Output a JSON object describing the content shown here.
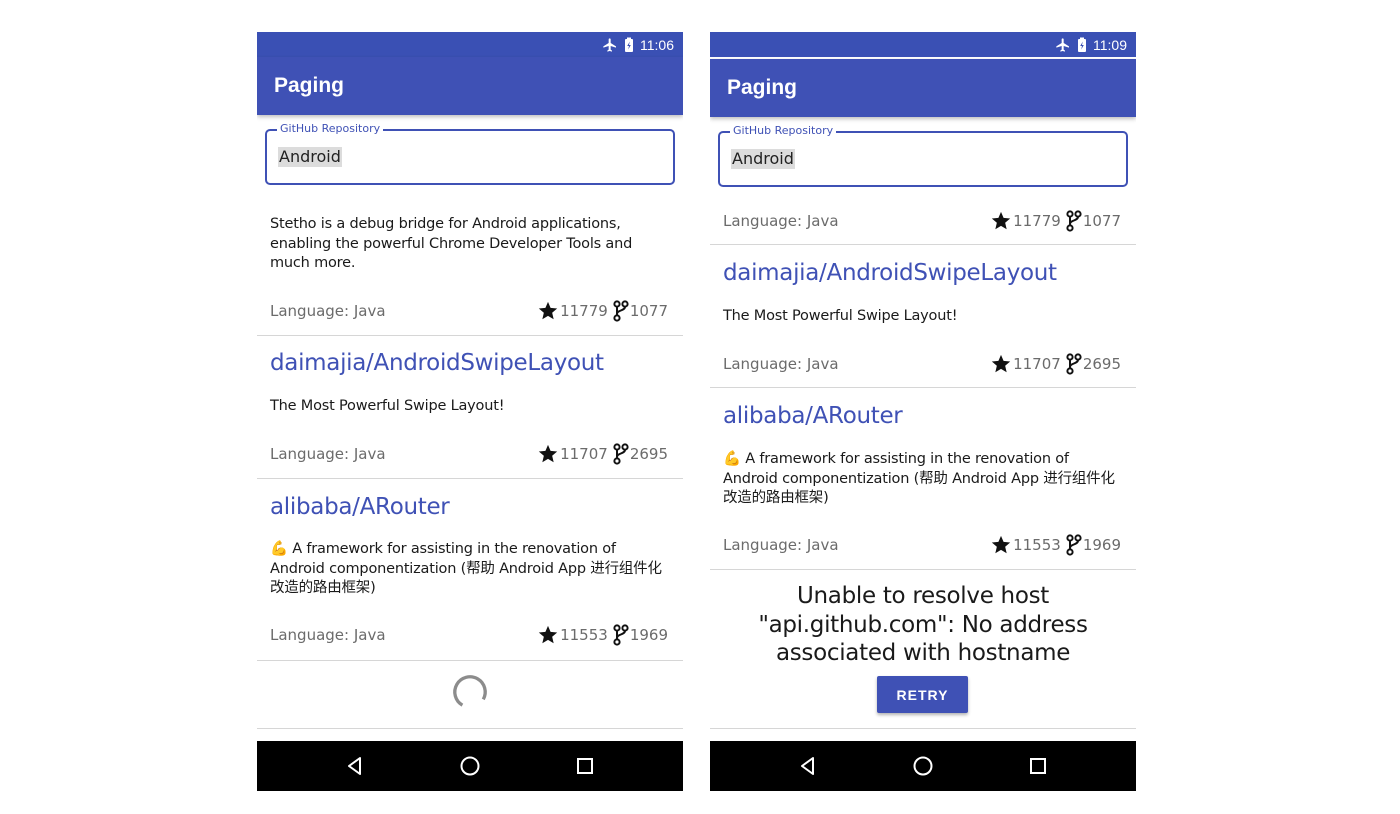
{
  "left": {
    "status": {
      "time": "11:06"
    },
    "app_title": "Paging",
    "search": {
      "label": "GitHub Repository",
      "value": "Android"
    },
    "items": [
      {
        "description": "Stetho is a debug bridge for Android applications, enabling the powerful Chrome Developer Tools and much more.",
        "language": "Language: Java",
        "stars": "11779",
        "forks": "1077"
      },
      {
        "name": "daimajia/AndroidSwipeLayout",
        "description": "The Most Powerful Swipe Layout!",
        "language": "Language: Java",
        "stars": "11707",
        "forks": "2695"
      },
      {
        "name": "alibaba/ARouter",
        "description": "💪 A framework for assisting in the renovation of Android componentization (帮助 Android App 进行组件化改造的路由框架)",
        "language": "Language: Java",
        "stars": "11553",
        "forks": "1969"
      }
    ]
  },
  "right": {
    "status": {
      "time": "11:09"
    },
    "app_title": "Paging",
    "search": {
      "label": "GitHub Repository",
      "value": "Android"
    },
    "items": [
      {
        "language": "Language: Java",
        "stars": "11779",
        "forks": "1077"
      },
      {
        "name": "daimajia/AndroidSwipeLayout",
        "description": "The Most Powerful Swipe Layout!",
        "language": "Language: Java",
        "stars": "11707",
        "forks": "2695"
      },
      {
        "name": "alibaba/ARouter",
        "description": "💪 A framework for assisting in the renovation of Android componentization (帮助 Android App 进行组件化改造的路由框架)",
        "language": "Language: Java",
        "stars": "11553",
        "forks": "1969"
      }
    ],
    "error": {
      "message": "Unable to resolve host \"api.github.com\": No address associated with hostname",
      "retry_label": "RETRY"
    }
  },
  "colors": {
    "primary": "#3f51b5",
    "status_bar": "#3a50b4",
    "link": "#3f51b5",
    "meta_text": "#6b6b6b"
  },
  "icons": [
    "airplane-icon",
    "battery-icon",
    "star-icon",
    "fork-icon",
    "back-icon",
    "home-icon",
    "recents-icon",
    "loading-spinner"
  ]
}
